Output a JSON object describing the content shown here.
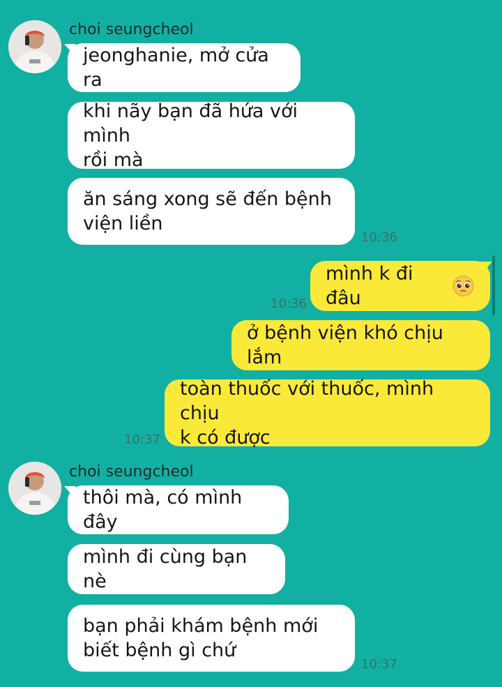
{
  "groups": [
    {
      "sender": "choi seungcheol",
      "messages": [
        "jeonghanie, mở cửa ra",
        "khi nãy bạn đã hứa với mình\nrồi mà",
        "ăn sáng xong sẽ đến bệnh\nviện liền"
      ],
      "time": "10:36"
    },
    {
      "outgoing": [
        {
          "text": "mình k đi đâu",
          "emoji": "pleading-face-emoji",
          "time": "10:36"
        },
        {
          "text": "ở bệnh viện khó chịu lắm"
        },
        {
          "text": "toàn thuốc với thuốc, mình chịu\nk có được",
          "time": "10:37"
        }
      ]
    },
    {
      "sender": "choi seungcheol",
      "messages": [
        "thôi mà, có mình đây",
        "mình đi cùng bạn nè",
        "bạn phải khám bệnh mới\nbiết bệnh gì chứ"
      ],
      "time": "10:37"
    }
  ],
  "colors": {
    "background": "#12b0a2",
    "incoming_bubble": "#ffffff",
    "outgoing_bubble": "#fbe93a",
    "timestamp": "#3d6f6a"
  }
}
